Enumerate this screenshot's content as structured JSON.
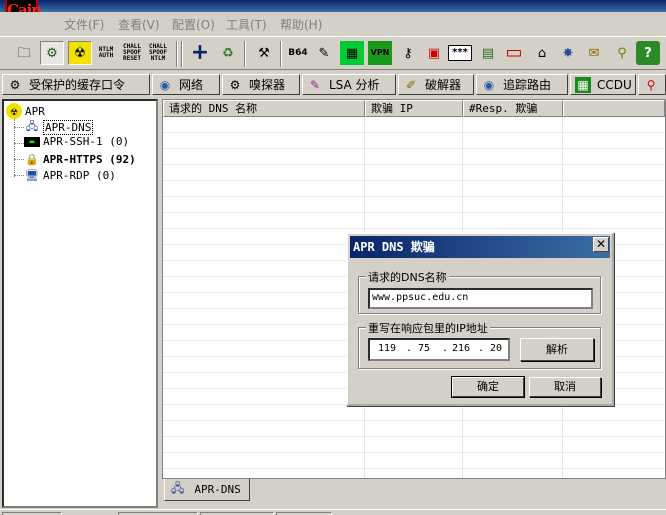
{
  "app": {
    "logo_text": "Cain",
    "menu": [
      "文件(F)",
      "查看(V)",
      "配置(O)",
      "工具(T)",
      "帮助(H)"
    ]
  },
  "toolbar": {
    "buttons": [
      {
        "name": "open-folder-icon",
        "glyph": "🗀"
      },
      {
        "name": "sniffer-icon",
        "glyph": "⚙"
      },
      {
        "name": "apr-icon",
        "glyph": "☢"
      },
      {
        "name": "ntlm-auth-icon",
        "text": "NTLM AUTH"
      },
      {
        "name": "chall-spoof-reset-icon",
        "text": "CHALL SPOOF RESET"
      },
      {
        "name": "chall-spoof-ntlm-icon",
        "text": "CHALL SPOOF NTLM"
      },
      {
        "name": "add-icon",
        "glyph": "+"
      },
      {
        "name": "delete-icon",
        "glyph": "♻"
      },
      {
        "name": "hash-calculator-icon",
        "glyph": "⚒"
      },
      {
        "name": "base64-icon",
        "text": "B64"
      },
      {
        "name": "wizard-icon",
        "glyph": "✎"
      },
      {
        "name": "equalizer-icon",
        "glyph": "▦"
      },
      {
        "name": "vpn-icon",
        "text": "VPN"
      },
      {
        "name": "key-icon",
        "glyph": "⚷"
      },
      {
        "name": "decoder-icon",
        "glyph": "▣"
      },
      {
        "name": "password-mask-icon",
        "text": "***"
      },
      {
        "name": "box-icon",
        "glyph": "▤"
      },
      {
        "name": "network-card-icon",
        "glyph": "▭"
      },
      {
        "name": "trace-icon",
        "glyph": "⌂"
      },
      {
        "name": "certificate-icon",
        "glyph": "✸"
      },
      {
        "name": "license-icon",
        "glyph": "✉"
      },
      {
        "name": "search-icon",
        "glyph": "⚲"
      },
      {
        "name": "info-icon",
        "glyph": "?"
      }
    ]
  },
  "tabs": [
    {
      "name": "tab-protected-storage",
      "label": "受保护的缓存口令",
      "icon": "⚙"
    },
    {
      "name": "tab-network",
      "label": "网络",
      "icon": "◉"
    },
    {
      "name": "tab-sniffer",
      "label": "嗅探器",
      "icon": "⚙"
    },
    {
      "name": "tab-lsa-secrets",
      "label": "LSA 分析",
      "icon": "✎"
    },
    {
      "name": "tab-cracker",
      "label": "破解器",
      "icon": "✐"
    },
    {
      "name": "tab-traceroute",
      "label": "追踪路由",
      "icon": "◉"
    },
    {
      "name": "tab-ccdu",
      "label": "CCDU",
      "icon": "▦"
    },
    {
      "name": "tab-wireless",
      "label": "",
      "icon": "⚲"
    }
  ],
  "tree": {
    "root": "APR",
    "items": [
      {
        "name": "tree-item-apr-dns",
        "label": "APR-DNS",
        "icon": "🖧",
        "bold": false,
        "selected": true
      },
      {
        "name": "tree-item-apr-ssh",
        "label": "APR-SSH-1 (0)",
        "icon": "▬",
        "bold": false,
        "selected": false
      },
      {
        "name": "tree-item-apr-https",
        "label": "APR-HTTPS (92)",
        "icon": "🔒",
        "bold": true,
        "selected": false
      },
      {
        "name": "tree-item-apr-rdp",
        "label": "APR-RDP (0)",
        "icon": "🖥",
        "bold": false,
        "selected": false
      }
    ]
  },
  "list": {
    "columns": [
      "请求的 DNS 名称",
      "欺骗 IP",
      "#Resp. 欺骗"
    ]
  },
  "bottom_tab": {
    "label": "APR-DNS",
    "icon": "🖧"
  },
  "dialog": {
    "title": "APR DNS 欺骗",
    "close_glyph": "✕",
    "group1_label": "请求的DNS名称",
    "dns_name_value": "www.ppsuc.edu.cn",
    "group2_label": "重写在响应包里的IP地址",
    "ip": [
      "119",
      "75",
      "216",
      "20"
    ],
    "resolve_label": "解析",
    "ok_label": "确定",
    "cancel_label": "取消"
  }
}
